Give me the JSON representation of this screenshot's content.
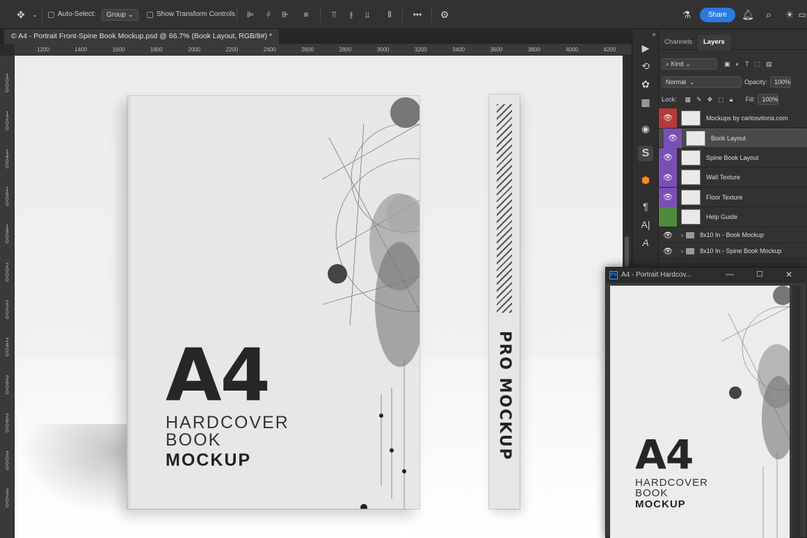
{
  "options_bar": {
    "auto_select_label": "Auto-Select:",
    "auto_select_value": "Group",
    "transform_label": "Show Transform Controls",
    "more_label": "•••",
    "share_label": "Share"
  },
  "document": {
    "tab_title": "© A4 - Portrait Front-Spine Book Mockup.psd @ 66.7% (Book Layout, RGB/8#) *"
  },
  "ruler": {
    "h_ticks": [
      "1200",
      "1400",
      "1600",
      "1800",
      "2000",
      "2200",
      "2400",
      "2600",
      "2800",
      "3000",
      "3200",
      "3400",
      "3600",
      "3800",
      "4000",
      "4200"
    ],
    "v_ticks": [
      "1000",
      "1200",
      "1400",
      "1600",
      "1800",
      "2000",
      "2200",
      "2400",
      "2600",
      "2800",
      "3000",
      "3200"
    ]
  },
  "mockup": {
    "big_text": "A4",
    "line1": "HARDCOVER",
    "line2": "BOOK",
    "line3": "MOCKUP",
    "spine_text": "PRO MOCKUP"
  },
  "panel": {
    "tabs": [
      "Channels",
      "Layers"
    ],
    "active_tab": "Layers",
    "kind_label": "Kind",
    "blend_mode": "Normal",
    "opacity_label": "Opacity:",
    "opacity_value": "100%",
    "lock_label": "Lock:",
    "fill_label": "Fill:",
    "fill_value": "100%",
    "layers": [
      {
        "name": "Mockups by carlosviloria.com",
        "color": "#b53a3a",
        "selected": false
      },
      {
        "name": "Book Layout",
        "color": "#7a4fb5",
        "selected": true
      },
      {
        "name": "Spine Book Layout",
        "color": "#7a4fb5",
        "selected": false
      },
      {
        "name": "Wall Texture",
        "color": "#7a4fb5",
        "selected": false
      },
      {
        "name": "Floor Texture",
        "color": "#7a4fb5",
        "selected": false
      },
      {
        "name": "Help Guide",
        "color": "#4f8a3a",
        "selected": false
      },
      {
        "name": "8x10 In - Book Mockup",
        "color": "",
        "selected": false
      },
      {
        "name": "8x10 In - Spine Book Mockup",
        "color": "",
        "selected": false
      }
    ]
  },
  "floating_window": {
    "title": "A4 - Portrait Hardcov...",
    "big_text": "A4",
    "line1": "HARDCOVER",
    "line2": "BOOK",
    "line3": "MOCKUP"
  },
  "colors": {
    "accent": "#2a7ae4",
    "purple_label": "#7a4fb5",
    "red_label": "#b53a3a",
    "green_label": "#4f8a3a"
  }
}
